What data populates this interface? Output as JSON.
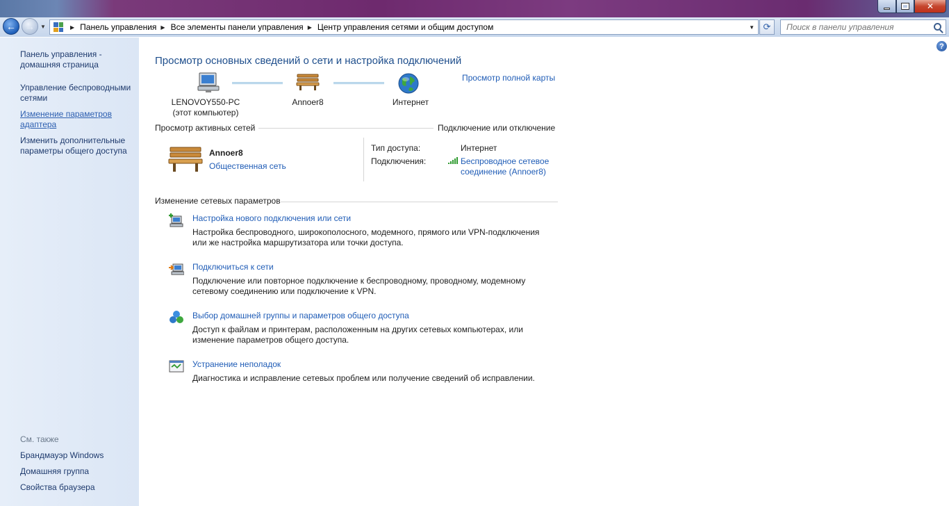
{
  "window": {
    "minimize_icon": "minimize-icon",
    "maximize_icon": "maximize-icon",
    "close_icon": "close-icon"
  },
  "navbar": {
    "back_icon": "back-arrow-icon",
    "forward_icon": "forward-arrow-icon",
    "breadcrumbs": [
      "Панель управления",
      "Все элементы панели управления",
      "Центр управления сетями и общим доступом"
    ],
    "search_placeholder": "Поиск в панели управления"
  },
  "sidebar": {
    "items": [
      {
        "label": "Панель управления - домашняя страница"
      },
      {
        "label": "Управление беспроводными сетями"
      },
      {
        "label": "Изменение параметров адаптера"
      },
      {
        "label": "Изменить дополнительные параметры общего доступа"
      }
    ],
    "see_also_label": "См. также",
    "see_also": [
      {
        "label": "Брандмауэр Windows"
      },
      {
        "label": "Домашняя группа"
      },
      {
        "label": "Свойства браузера"
      }
    ]
  },
  "main": {
    "title": "Просмотр основных сведений о сети и настройка подключений",
    "full_map_link": "Просмотр полной карты",
    "map": {
      "computer_name": "LENOVOY550-PC",
      "computer_sub": "(этот компьютер)",
      "network_name": "Annoer8",
      "internet": "Интернет"
    },
    "active_networks": {
      "heading": "Просмотр активных сетей",
      "connect_link": "Подключение или отключение",
      "network_name": "Annoer8",
      "network_type": "Общественная сеть",
      "access_type_label": "Тип доступа:",
      "access_type_value": "Интернет",
      "connections_label": "Подключения:",
      "connection_value_line1": "Беспроводное сетевое",
      "connection_value_line2": "соединение (Annoer8)",
      "signal_bars": 5
    },
    "change_settings": {
      "heading": "Изменение сетевых параметров",
      "tasks": [
        {
          "icon": "new-connection-icon",
          "title": "Настройка нового подключения или сети",
          "desc1": "Настройка беспроводного, широкополосного, модемного, прямого или VPN-подключения",
          "desc2": "или же настройка маршрутизатора или точки доступа."
        },
        {
          "icon": "connect-network-icon",
          "title": "Подключиться к сети",
          "desc1": "Подключение или повторное подключение к беспроводному, проводному, модемному",
          "desc2": "сетевому соединению или подключение к VPN."
        },
        {
          "icon": "homegroup-icon",
          "title": "Выбор домашней группы и параметров общего доступа",
          "desc1": "Доступ к файлам и принтерам, расположенным на других сетевых компьютерах, или",
          "desc2": "изменение параметров общего доступа."
        },
        {
          "icon": "troubleshoot-icon",
          "title": "Устранение неполадок",
          "desc1": "Диагностика и исправление сетевых проблем или получение сведений об исправлении.",
          "desc2": ""
        }
      ]
    }
  }
}
